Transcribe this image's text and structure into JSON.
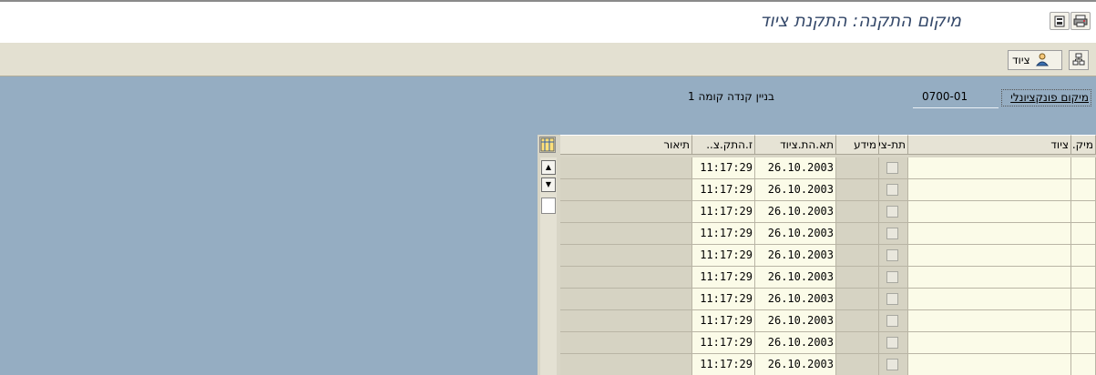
{
  "window": {
    "title": "מיקום התקנה: התקנת ציוד"
  },
  "toolbar": {
    "equipment_button_label": "ציוד"
  },
  "functional_location": {
    "label": "מיקום פונקציונלי",
    "value": "0700-01",
    "description": "בניין קנדה קומה 1"
  },
  "table": {
    "columns": [
      "מיק.",
      "ציוד",
      "תת-צי",
      "מידע",
      "תא.הת.ציוד",
      "ז.התק.צ..",
      "תיאור"
    ],
    "rows": [
      {
        "date": "26.10.2003",
        "time": "11:17:29"
      },
      {
        "date": "26.10.2003",
        "time": "11:17:29"
      },
      {
        "date": "26.10.2003",
        "time": "11:17:29"
      },
      {
        "date": "26.10.2003",
        "time": "11:17:29"
      },
      {
        "date": "26.10.2003",
        "time": "11:17:29"
      },
      {
        "date": "26.10.2003",
        "time": "11:17:29"
      },
      {
        "date": "26.10.2003",
        "time": "11:17:29"
      },
      {
        "date": "26.10.2003",
        "time": "11:17:29"
      },
      {
        "date": "26.10.2003",
        "time": "11:17:29"
      },
      {
        "date": "26.10.2003",
        "time": "11:17:29"
      }
    ]
  },
  "icons": {
    "title_left": "display-change-icon",
    "title_right": "print-icon",
    "toolbar_equipment": "person-equipment-icon",
    "toolbar_structure": "hierarchy-icon",
    "table_settings": "column-settings-icon",
    "scroll_up": "arrow-up-icon",
    "scroll_down": "arrow-down-icon"
  },
  "colors": {
    "background": "#95adc2",
    "title_text": "#35496a",
    "toolbar": "#e3e0d1",
    "input_cell": "#fbfbe8",
    "readonly_cell": "#d6d3c3"
  }
}
